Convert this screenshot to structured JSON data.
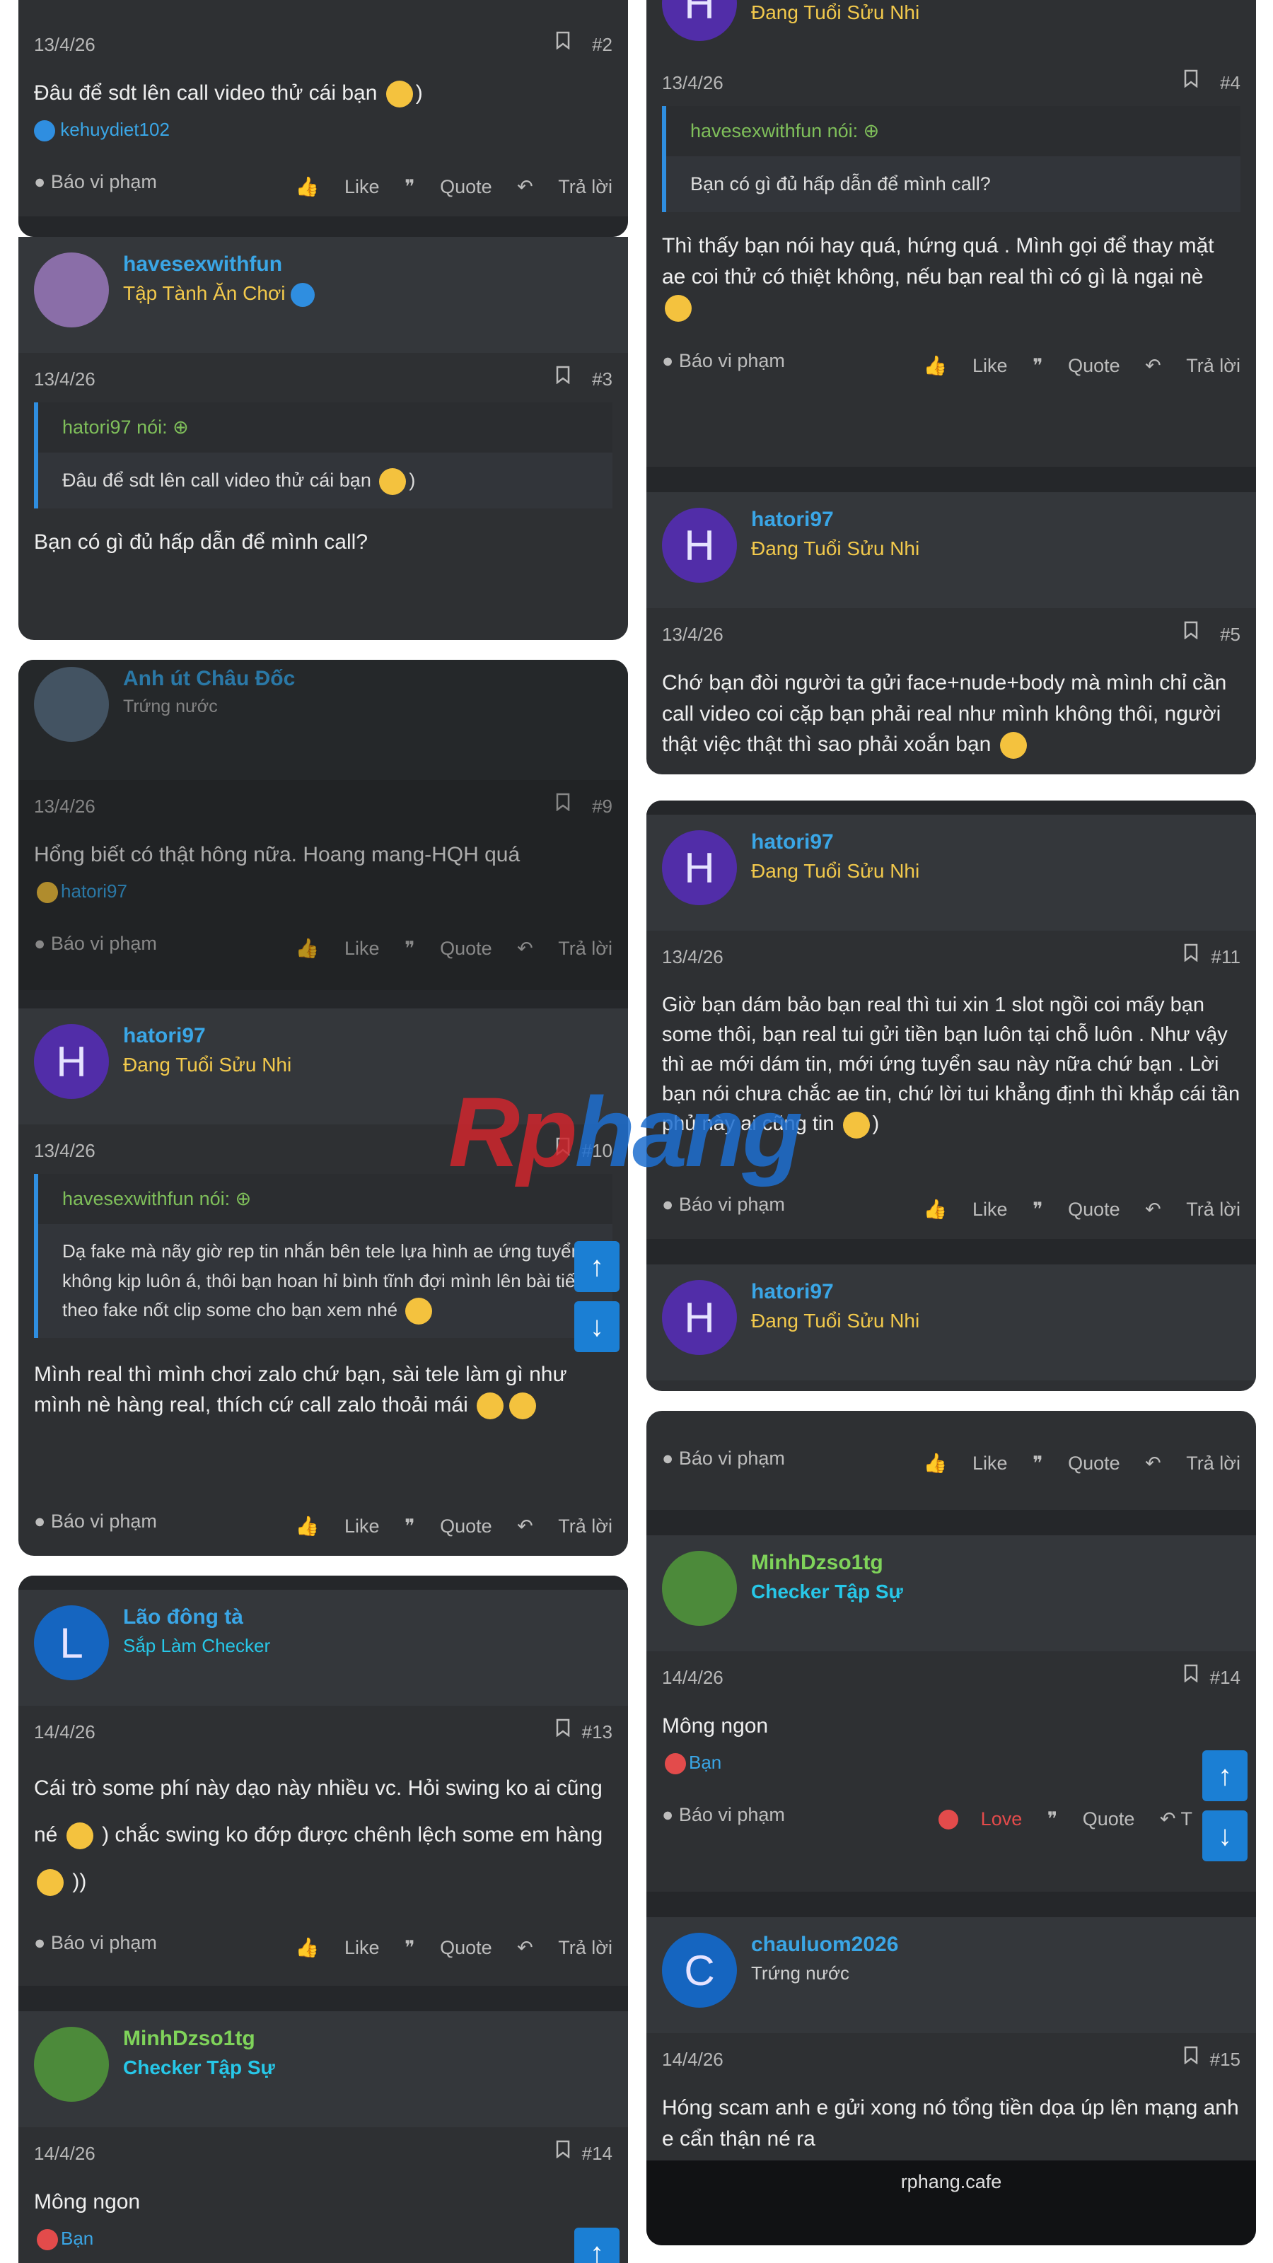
{
  "colors": {
    "user_blue": "#3aa6e6",
    "title_yellow": "#f2c94c",
    "title_cyan": "#27c7e8",
    "green_user": "#7fd35a",
    "love_red": "#e34b4b"
  },
  "common": {
    "report": "Báo vi phạm",
    "like": "Like",
    "quote": "Quote",
    "reply": "Trả lời"
  },
  "left": {
    "p2": {
      "date": "13/4/26",
      "num": "#2",
      "text": "Đâu để sdt lên call video thử cái bạn",
      "react_user": "kehuydiet102"
    },
    "p3": {
      "user": "havesexwithfun",
      "title": "Tập Tành Ăn Chơi",
      "date": "13/4/26",
      "num": "#3",
      "quote_head": "hatori97 nói:",
      "quote_body": "Đâu để sdt lên call video thử cái bạn",
      "text": "Bạn có gì đủ hấp dẫn để mình call?"
    },
    "p9": {
      "user": "Anh út Châu Đốc",
      "title": "Trứng nước",
      "date": "13/4/26",
      "num": "#9",
      "text": "Hổng biết có thật hông nữa. Hoang mang-HQH quá",
      "react_user": "hatori97"
    },
    "p10": {
      "user": "hatori97",
      "title": "Đang Tuổi Sửu Nhi",
      "initial": "H",
      "date": "13/4/26",
      "num": "#10",
      "quote_head": "havesexwithfun nói:",
      "quote_body": "Dạ fake mà nãy giờ rep tin nhắn bên tele lựa hình ae ứng tuyển không kịp luôn á, thôi bạn hoan hỉ bình tĩnh đợi mình lên bài tiếp theo fake nốt clip some cho bạn xem nhé",
      "text": "Mình real thì mình chơi zalo chứ bạn, sài tele làm gì như mình nè hàng real, thích cứ call zalo thoải mái"
    },
    "p13": {
      "user": "Lão đông tà",
      "title": "Sắp Làm Checker",
      "initial": "L",
      "date": "14/4/26",
      "num": "#13",
      "text1": "Cái trò some phí này dạo này nhiều vc. Hỏi swing ko ai cũng né",
      "text2": ") chắc swing ko đớp được chênh lệch some em hàng",
      "text3": "))"
    },
    "p14": {
      "user": "MinhDzso1tg",
      "title": "Checker Tập Sự",
      "date": "14/4/26",
      "num": "#14",
      "text": "Mông ngon",
      "react_user": "Bạn"
    }
  },
  "right": {
    "top": {
      "title": "Đang Tuổi Sửu Nhi",
      "date": "13/4/26",
      "num": "#4",
      "quote_head": "havesexwithfun nói:",
      "quote_body": "Bạn có gì đủ hấp dẫn để mình call?",
      "text": "Thì thấy bạn nói hay quá, hứng quá . Mình gọi để thay mặt ae coi thử có thiệt không, nếu bạn real thì có gì là ngại nè"
    },
    "p5": {
      "user": "hatori97",
      "title": "Đang Tuổi Sửu Nhi",
      "initial": "H",
      "date": "13/4/26",
      "num": "#5",
      "text": "Chớ bạn đòi người ta gửi face+nude+body mà mình chỉ cần call video coi cặp bạn phải real như mình không thôi, người thật việc thật thì sao phải xoắn bạn"
    },
    "p11": {
      "user": "hatori97",
      "title": "Đang Tuổi Sửu Nhi",
      "initial": "H",
      "date": "13/4/26",
      "num": "#11",
      "text": "Giờ bạn dám bảo bạn real thì tui xin 1 slot ngồi coi mấy bạn some thôi, bạn real tui gửi tiền bạn luôn tại chỗ luôn . Như vậy thì ae mới dám tin, mới ứng tuyển sau này nữa chứ bạn . Lời bạn nói chưa chắc ae tin, chứ lời tui khẳng định thì khắp cái tần phủ này ai cũng tin"
    },
    "p12": {
      "user": "hatori97",
      "title": "Đang Tuổi Sửu Nhi",
      "initial": "H"
    },
    "p14": {
      "user": "MinhDzso1tg",
      "title": "Checker Tập Sự",
      "date": "14/4/26",
      "num": "#14",
      "text": "Mông ngon",
      "react_user": "Bạn",
      "love": "Love"
    },
    "p15": {
      "user": "chauluom2026",
      "title": "Trứng nước",
      "initial": "C",
      "date": "14/4/26",
      "num": "#15",
      "text": "Hóng scam anh e gửi xong nó tổng tiền dọa úp lên mạng anh e cẩn thận né ra"
    },
    "site": "rphang.cafe"
  },
  "watermark": {
    "part1": "Rp",
    "part2": "hang"
  },
  "scroll": {
    "up": "↑",
    "down": "↓"
  }
}
